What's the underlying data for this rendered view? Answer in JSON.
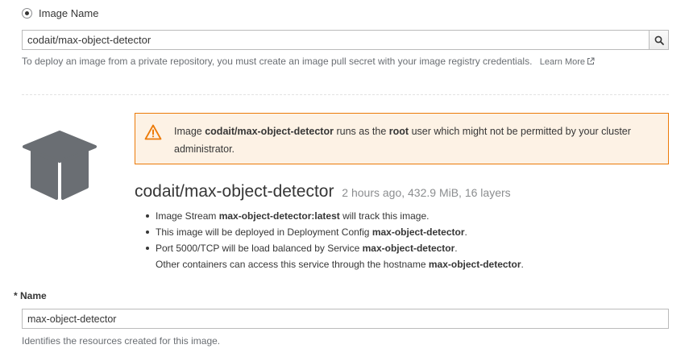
{
  "deploy_source": {
    "image_name_radio_label": "Image Name",
    "image_name_value": "codait/max-object-detector",
    "help_text": "To deploy an image from a private repository, you must create an image pull secret with your image registry credentials.",
    "learn_more_label": "Learn More"
  },
  "warning": {
    "prefix": "Image ",
    "image": "codait/max-object-detector",
    "middle": " runs as the ",
    "user": "root",
    "suffix": " user which might not be permitted by your cluster administrator."
  },
  "image_info": {
    "name": "codait/max-object-detector",
    "meta": "2 hours ago, 432.9 MiB, 16 layers",
    "bullets": [
      {
        "pre": "Image Stream ",
        "bold": "max-object-detector:latest",
        "post": " will track this image."
      },
      {
        "pre": "This image will be deployed in Deployment Config ",
        "bold": "max-object-detector",
        "post": "."
      },
      {
        "pre": "Port 5000/TCP will be load balanced by Service ",
        "bold": "max-object-detector",
        "post": "."
      },
      {
        "pre": "Other containers can access this service through the hostname ",
        "bold": "max-object-detector",
        "post": "."
      }
    ]
  },
  "name_field": {
    "required_marker": "*",
    "label": "Name",
    "value": "max-object-detector",
    "help": "Identifies the resources created for this image."
  },
  "colors": {
    "warning_border": "#ec7a08",
    "warning_background": "#fdf2e5",
    "cube_fill": "#6a6e73"
  },
  "icons": [
    "radio-selected",
    "search-icon",
    "external-link-icon",
    "warning-triangle-icon",
    "cube-icon"
  ]
}
